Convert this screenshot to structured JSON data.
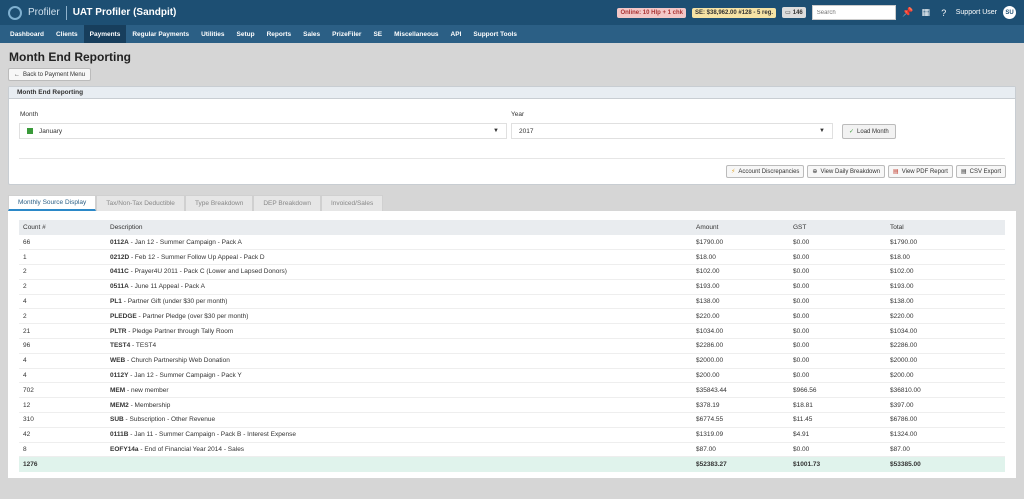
{
  "header": {
    "brand": "Profiler",
    "app_title": "UAT Profiler (Sandpit)",
    "badge_online": "Online: 10 Hlp + 1 chk",
    "badge_se": "SE: $38,962.00 #128 - 5 reg.",
    "badge_count": "146",
    "search_placeholder": "Search",
    "user_name": "Support User",
    "user_initials": "SU"
  },
  "nav": [
    "Dashboard",
    "Clients",
    "Payments",
    "Regular Payments",
    "Utilities",
    "Setup",
    "Reports",
    "Sales",
    "PrizeFiler",
    "SE",
    "Miscellaneous",
    "API",
    "Support Tools"
  ],
  "nav_active": "Payments",
  "page": {
    "title": "Month End Reporting",
    "back_label": "Back to Payment Menu"
  },
  "panel": {
    "title": "Month End Reporting",
    "month_label": "Month",
    "month_value": "January",
    "year_label": "Year",
    "year_value": "2017",
    "load_label": "Load Month",
    "actions": [
      "Account Discrepancies",
      "View Daily Breakdown",
      "View PDF Report",
      "CSV Export"
    ]
  },
  "tabs": [
    "Monthly Source Display",
    "Tax/Non-Tax Deductible",
    "Type Breakdown",
    "DEP Breakdown",
    "Invoiced/Sales"
  ],
  "table": {
    "headers": [
      "Count #",
      "Description",
      "Amount",
      "GST",
      "Total"
    ],
    "rows": [
      {
        "count": "66",
        "code": "0112A",
        "desc": " - Jan 12 - Summer Campaign - Pack A",
        "amount": "$1790.00",
        "gst": "$0.00",
        "total": "$1790.00"
      },
      {
        "count": "1",
        "code": "0212D",
        "desc": " - Feb 12 - Summer Follow Up Appeal - Pack D",
        "amount": "$18.00",
        "gst": "$0.00",
        "total": "$18.00"
      },
      {
        "count": "2",
        "code": "0411C",
        "desc": " - Prayer4U 2011 - Pack C (Lower and Lapsed Donors)",
        "amount": "$102.00",
        "gst": "$0.00",
        "total": "$102.00"
      },
      {
        "count": "2",
        "code": "0511A",
        "desc": " - June 11 Appeal - Pack A",
        "amount": "$193.00",
        "gst": "$0.00",
        "total": "$193.00"
      },
      {
        "count": "4",
        "code": "PL1",
        "desc": " - Partner Gift (under $30 per month)",
        "amount": "$138.00",
        "gst": "$0.00",
        "total": "$138.00"
      },
      {
        "count": "2",
        "code": "PLEDGE",
        "desc": " - Partner Pledge (over $30 per month)",
        "amount": "$220.00",
        "gst": "$0.00",
        "total": "$220.00"
      },
      {
        "count": "21",
        "code": "PLTR",
        "desc": " - Pledge Partner through Tally Room",
        "amount": "$1034.00",
        "gst": "$0.00",
        "total": "$1034.00"
      },
      {
        "count": "96",
        "code": "TEST4",
        "desc": " - TEST4",
        "amount": "$2286.00",
        "gst": "$0.00",
        "total": "$2286.00"
      },
      {
        "count": "4",
        "code": "WEB",
        "desc": " - Church Partnership Web Donation",
        "amount": "$2000.00",
        "gst": "$0.00",
        "total": "$2000.00"
      },
      {
        "count": "4",
        "code": "0112Y",
        "desc": " - Jan 12 - Summer Campaign - Pack Y",
        "amount": "$200.00",
        "gst": "$0.00",
        "total": "$200.00"
      },
      {
        "count": "702",
        "code": "MEM",
        "desc": " - new member",
        "amount": "$35843.44",
        "gst": "$966.56",
        "total": "$36810.00"
      },
      {
        "count": "12",
        "code": "MEM2",
        "desc": " - Membership",
        "amount": "$378.19",
        "gst": "$18.81",
        "total": "$397.00"
      },
      {
        "count": "310",
        "code": "SUB",
        "desc": " - Subscription - Other Revenue",
        "amount": "$6774.55",
        "gst": "$11.45",
        "total": "$6786.00"
      },
      {
        "count": "42",
        "code": "0111B",
        "desc": " - Jan 11 - Summer Campaign - Pack B - Interest Expense",
        "amount": "$1319.09",
        "gst": "$4.91",
        "total": "$1324.00"
      },
      {
        "count": "8",
        "code": "EOFY14a",
        "desc": " - End of Financial Year 2014 - Sales",
        "amount": "$87.00",
        "gst": "$0.00",
        "total": "$87.00"
      }
    ],
    "total": {
      "count": "1276",
      "amount": "$52383.27",
      "gst": "$1001.73",
      "total": "$53385.00"
    }
  }
}
